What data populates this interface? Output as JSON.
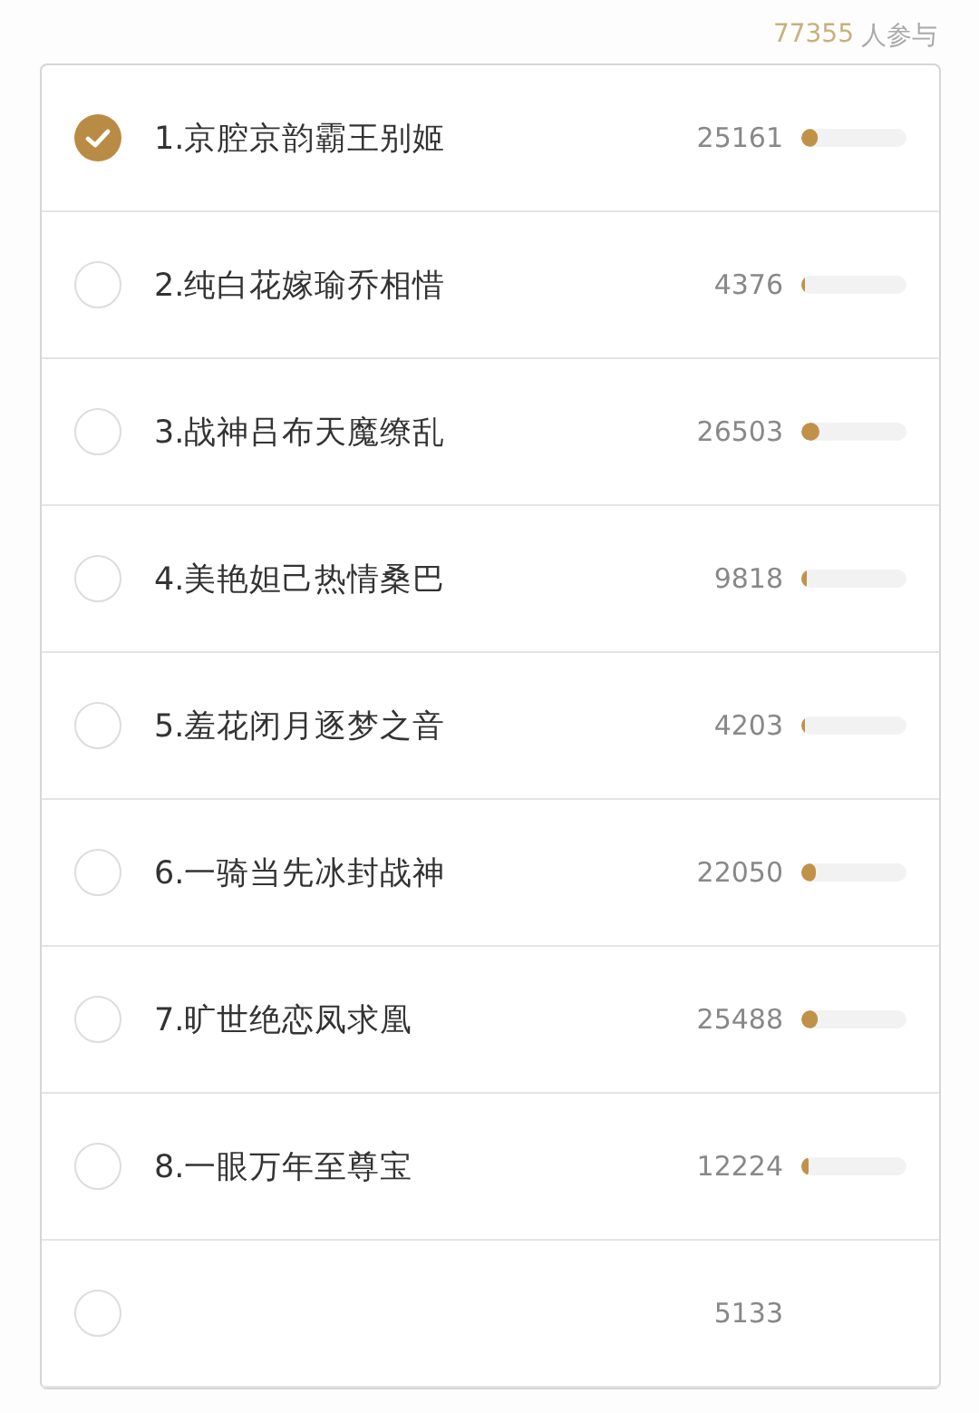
{
  "participants": {
    "count": "77355",
    "label": "人参与"
  },
  "options": [
    {
      "label": "1.京腔京韵霸王别姬",
      "votes": "25161",
      "level": 0.16,
      "selected": true
    },
    {
      "label": "2.纯白花嫁瑜乔相惜",
      "votes": "4376",
      "level": 0.03,
      "selected": false
    },
    {
      "label": "3.战神吕布天魔缭乱",
      "votes": "26503",
      "level": 0.17,
      "selected": false
    },
    {
      "label": "4.美艳妲己热情桑巴",
      "votes": "9818",
      "level": 0.06,
      "selected": false
    },
    {
      "label": "5.羞花闭月逐梦之音",
      "votes": "4203",
      "level": 0.03,
      "selected": false
    },
    {
      "label": "6.一骑当先冰封战神",
      "votes": "22050",
      "level": 0.14,
      "selected": false
    },
    {
      "label": "7.旷世绝恋凤求凰",
      "votes": "25488",
      "level": 0.16,
      "selected": false
    },
    {
      "label": "8.一眼万年至尊宝",
      "votes": "12224",
      "level": 0.07,
      "selected": false
    },
    {
      "votes": "5133",
      "selected": false
    }
  ]
}
